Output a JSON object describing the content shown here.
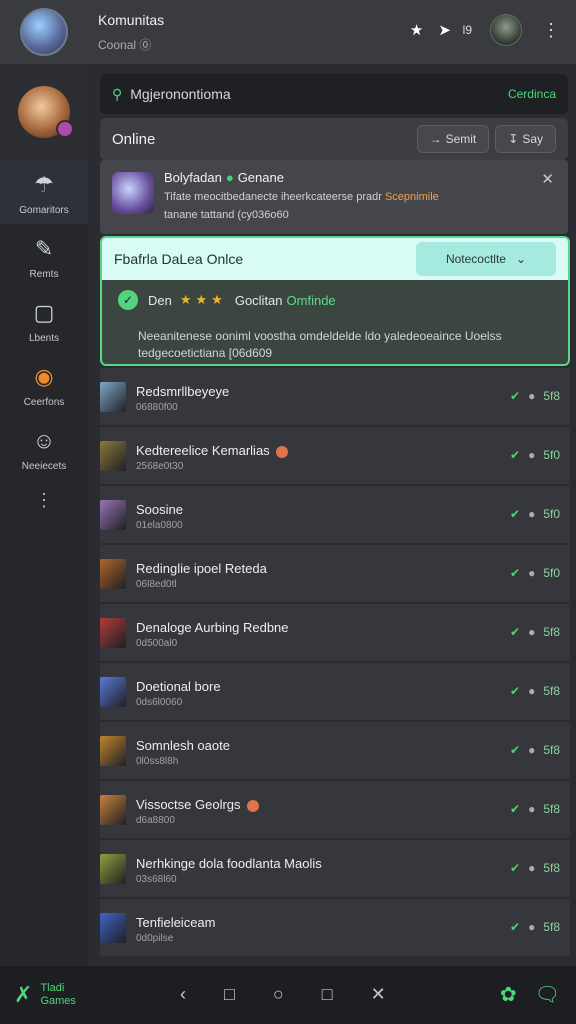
{
  "header": {
    "title": "Komunitas",
    "subtitle": "Coonal ⓪",
    "count": "l9"
  },
  "icons": {
    "pin": "★",
    "send": "➤",
    "kebab": "⋮"
  },
  "sidebar": {
    "items": [
      {
        "label": "Gomaritors",
        "icon": "☂"
      },
      {
        "label": "Remts",
        "icon": "✎"
      },
      {
        "label": "Lbents",
        "icon": "▢"
      },
      {
        "label": "Ceerfons",
        "icon": "◉"
      },
      {
        "label": "Neeiecets",
        "icon": "☺"
      }
    ],
    "more": "⋮"
  },
  "search": {
    "text": "Mgjeronontioma",
    "action": "Cerdinca"
  },
  "online": {
    "title": "Online",
    "btn1": "Semit",
    "btn2": "Say"
  },
  "notice": {
    "title": "Bolyfadan",
    "status": "Genane",
    "line1": "Tifate meocitbedanecte iheerkcateerse pradr",
    "link": "Scepnimile",
    "line2": "tanane tattand (cy036o60",
    "close": "✕"
  },
  "featured": {
    "title": "Fbafrla DaLea Onlce",
    "button": "Notecoctlte",
    "name": "Den",
    "stars": "★★★",
    "status_prefix": "Goclitan",
    "status": "Omfinde",
    "desc": "Neeanitenese ooniml voostha omdeldelde ldo yaledeoeaince Uoelss tedgecoetictiana [06d609"
  },
  "list": [
    {
      "name": "Redsmrllbeyeye",
      "sub": "06880f00",
      "badge": false,
      "value": "5f8",
      "color": "#7fa9c9"
    },
    {
      "name": "Kedtereelice Kemarlias",
      "sub": "2568e0t30",
      "badge": true,
      "value": "5f0",
      "color": "#8a7a3c"
    },
    {
      "name": "Soosine",
      "sub": "01ela0800",
      "badge": false,
      "value": "5f0",
      "color": "#9a73b8"
    },
    {
      "name": "Redinglie ipoel Reteda",
      "sub": "06l8ed0tl",
      "badge": false,
      "value": "5f0",
      "color": "#b0652c"
    },
    {
      "name": "Denaloge Aurbing Redbne",
      "sub": "0d500al0",
      "badge": false,
      "value": "5f8",
      "color": "#b13b3b"
    },
    {
      "name": "Doetional bore",
      "sub": "0ds6l0060",
      "badge": false,
      "value": "5f8",
      "color": "#5a7ad8"
    },
    {
      "name": "Somnlesh oaote",
      "sub": "0l0ss8l8h",
      "badge": false,
      "value": "5f8",
      "color": "#c2862d"
    },
    {
      "name": "Vissoctse Geolrgs",
      "sub": "d6a8800",
      "badge": true,
      "value": "5f8",
      "color": "#c9823a"
    },
    {
      "name": "Nerhkinge dola foodlanta Maolis",
      "sub": "03s68l60",
      "badge": false,
      "value": "5f8",
      "color": "#8fa23a"
    },
    {
      "name": "Tenfieleiceam",
      "sub": "0d0pilse",
      "badge": false,
      "value": "5f8",
      "color": "#3f63c9"
    }
  ],
  "bottom": {
    "brand_line1": "Tladi",
    "brand_line2": "Games"
  }
}
